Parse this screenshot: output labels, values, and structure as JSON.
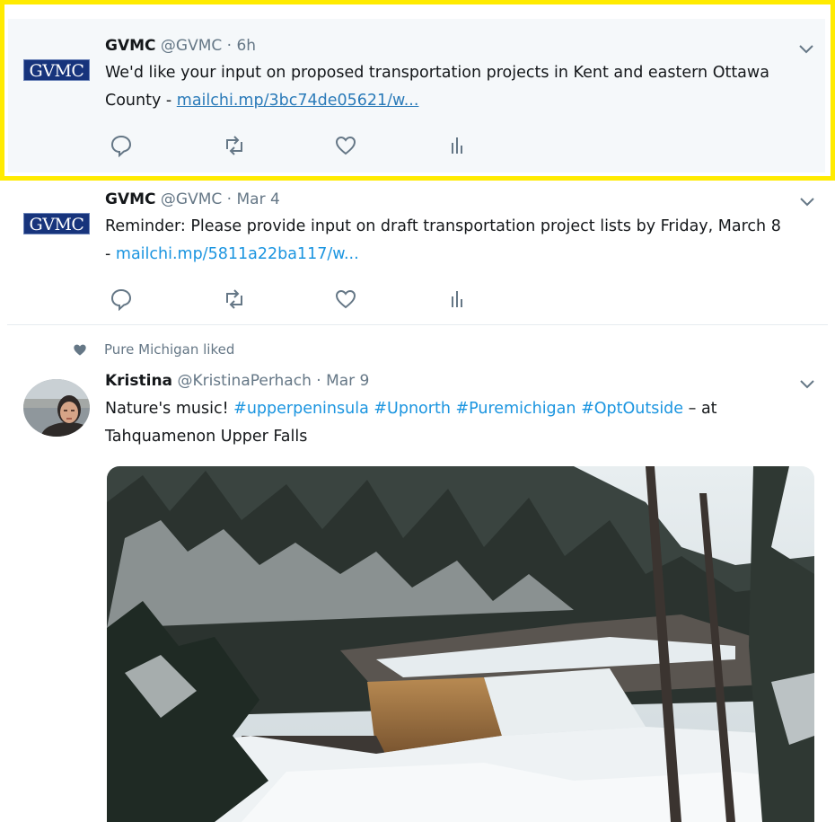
{
  "tweets": [
    {
      "logo_text": "GVMC",
      "name": "GVMC",
      "handle": "@GVMC",
      "separator": "·",
      "time": "6h",
      "text_before": "We'd like your input on proposed transportation projects in Kent and eastern Ottawa County - ",
      "link": "mailchi.mp/3bc74de05621/w...",
      "highlighted": true,
      "highlight_color": "#ffeb00"
    },
    {
      "logo_text": "GVMC",
      "name": "GVMC",
      "handle": "@GVMC",
      "separator": "·",
      "time": "Mar 4",
      "text_before": "Reminder: Please provide input on draft transportation project lists by Friday, March 8 - ",
      "link": "mailchi.mp/5811a22ba117/w..."
    },
    {
      "liked_by": "Pure Michigan liked",
      "name": "Kristina",
      "handle": "@KristinaPerhach",
      "separator": "·",
      "time": "Mar 9",
      "text_before": "Nature's music! ",
      "hashtags": [
        "#upperpeninsula",
        "#Upnorth",
        "#Puremichigan",
        "#OptOutside"
      ],
      "text_after": " – at Tahquamenon Upper Falls",
      "has_photo": true
    }
  ],
  "icons": {
    "reply": "reply-icon",
    "retweet": "retweet-icon",
    "like": "heart-icon",
    "analytics": "analytics-icon",
    "caret": "chevron-down-icon",
    "liked": "heart-filled-icon"
  },
  "colors": {
    "link": "#1b95e0",
    "muted": "#657786",
    "text": "#14171a",
    "logo_bg": "#17347c",
    "highlight": "#ffeb00"
  }
}
